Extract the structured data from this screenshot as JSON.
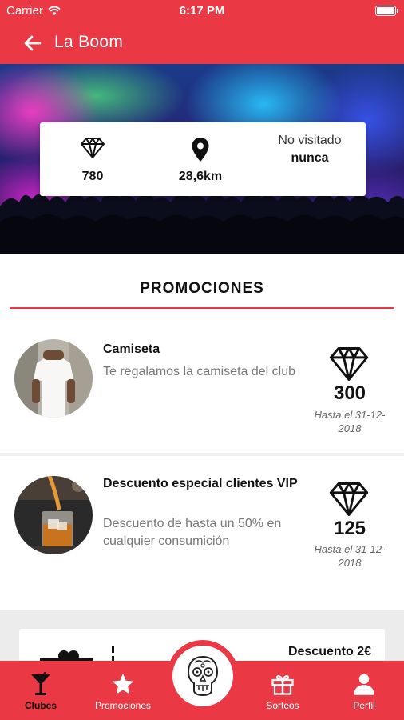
{
  "status_bar": {
    "carrier": "Carrier",
    "time": "6:17 PM"
  },
  "nav": {
    "title": "La Boom"
  },
  "stats": {
    "gems": "780",
    "distance": "28,6km",
    "visited_label": "No visitado",
    "visited_value": "nunca"
  },
  "promotions": {
    "heading": "PROMOCIONES",
    "items": [
      {
        "name": "Camiseta",
        "description": "Te regalamos la camiseta del club",
        "cost": "300",
        "valid_until": "Hasta el 31-12-2018"
      },
      {
        "name": "Descuento especial clientes VIP",
        "description": "Descuento de hasta un 50% en cualquier consumición",
        "cost": "125",
        "valid_until": "Hasta el 31-12-2018"
      },
      {
        "name": "Descuento 2€"
      }
    ]
  },
  "tabs": {
    "clubes": "Clubes",
    "promociones": "Promociones",
    "sorteos": "Sorteos",
    "perfil": "Perfil"
  },
  "colors": {
    "accent": "#ea3844"
  }
}
